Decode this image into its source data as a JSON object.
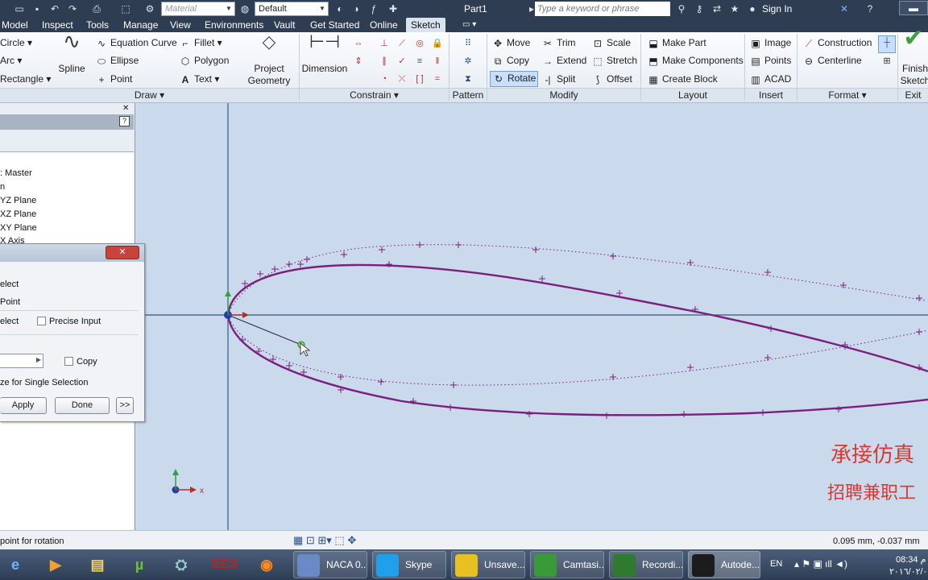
{
  "titlebar": {
    "material": "Material",
    "appearance": "Default",
    "doc_title": "Part1",
    "search_placeholder": "Type a keyword or phrase",
    "sign_in": "Sign In"
  },
  "menu_tabs": [
    "Model",
    "Inspect",
    "Tools",
    "Manage",
    "View",
    "Environments",
    "Vault",
    "Get Started",
    "Online",
    "Sketch"
  ],
  "ribbon": {
    "draw": {
      "circle": "Circle",
      "arc": "Arc",
      "rectangle": "Rectangle",
      "spline": "Spline",
      "equation_curve": "Equation Curve",
      "ellipse": "Ellipse",
      "point": "Point",
      "fillet": "Fillet",
      "polygon": "Polygon",
      "text": "Text",
      "project_geometry_1": "Project",
      "project_geometry_2": "Geometry",
      "group": "Draw"
    },
    "constrain": {
      "dimension": "Dimension",
      "group": "Constrain"
    },
    "pattern": {
      "group": "Pattern"
    },
    "modify": {
      "move": "Move",
      "copy": "Copy",
      "rotate": "Rotate",
      "trim": "Trim",
      "extend": "Extend",
      "split": "Split",
      "scale": "Scale",
      "stretch": "Stretch",
      "offset": "Offset",
      "group": "Modify"
    },
    "layout": {
      "make_part": "Make Part",
      "make_components": "Make Components",
      "create_block": "Create Block",
      "group": "Layout"
    },
    "insert": {
      "image": "Image",
      "points": "Points",
      "acad": "ACAD",
      "group": "Insert"
    },
    "format": {
      "construction": "Construction",
      "centerline": "Centerline",
      "group": "Format"
    },
    "exit": {
      "finish_1": "Finish",
      "finish_2": "Sketch",
      "group": "Exit"
    }
  },
  "browser": {
    "items": [
      ": Master",
      "n",
      "YZ Plane",
      "XZ Plane",
      "XY Plane",
      "X Axis"
    ]
  },
  "dialog": {
    "select_1": "elect",
    "point": "Point",
    "select_2": "elect",
    "precise_input": "Precise Input",
    "copy": "Copy",
    "single_selection": "ze for Single Selection",
    "apply": "Apply",
    "done": "Done",
    "more": ">>"
  },
  "canvas": {
    "overlay_line1": "承接仿真",
    "overlay_line2": "招聘兼职工"
  },
  "status": {
    "prompt": "point for rotation",
    "coords": "0.095 mm, -0.037 mm"
  },
  "taskbar": {
    "items": [
      "NACA 0...",
      "Skype",
      "Unsave...",
      "Camtasi...",
      "Recordi...",
      "Autode..."
    ],
    "lang": "EN",
    "time": "08:34 م",
    "date": "٢٠١٦/٠٢/٠"
  },
  "colors": {
    "titlebar": "#2e3d52",
    "canvas": "#cad9ec",
    "airfoil": "#7a1f7a",
    "axis": "#2a5f80",
    "overlay_text": "#d43a32"
  }
}
